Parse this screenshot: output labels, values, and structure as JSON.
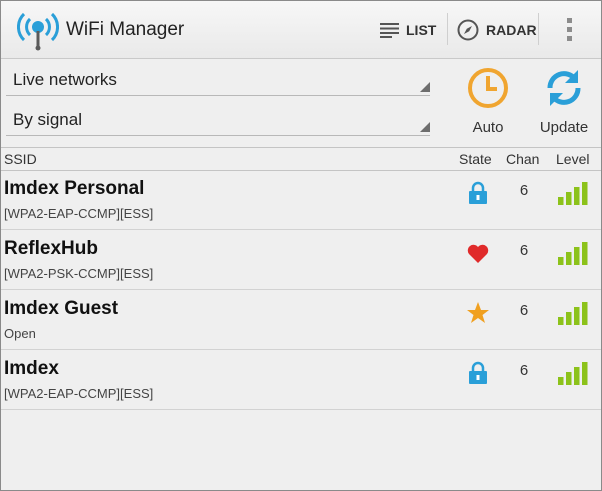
{
  "app": {
    "title": "WiFi Manager"
  },
  "actionbar": {
    "list_label": "LIST",
    "radar_label": "RADAR"
  },
  "filters": {
    "network_filter": "Live networks",
    "sort_order": "By signal"
  },
  "controls": {
    "auto_label": "Auto",
    "update_label": "Update"
  },
  "columns": {
    "ssid": "SSID",
    "state": "State",
    "chan": "Chan",
    "level": "Level"
  },
  "colors": {
    "accent": "#2a9fd8",
    "signal": "#8cc21a",
    "auto_orange": "#f0a530",
    "heart": "#e02a2a",
    "star": "#f0a020"
  },
  "networks": [
    {
      "ssid": "Imdex Personal",
      "security": "[WPA2-EAP-CCMP][ESS]",
      "state_icon": "lock-icon",
      "channel": "6",
      "signal_bars": 4
    },
    {
      "ssid": "ReflexHub",
      "security": "[WPA2-PSK-CCMP][ESS]",
      "state_icon": "heart-icon",
      "channel": "6",
      "signal_bars": 4
    },
    {
      "ssid": "Imdex Guest",
      "security": "Open",
      "state_icon": "star-icon",
      "channel": "6",
      "signal_bars": 4
    },
    {
      "ssid": "Imdex",
      "security": "[WPA2-EAP-CCMP][ESS]",
      "state_icon": "lock-icon",
      "channel": "6",
      "signal_bars": 4
    }
  ]
}
